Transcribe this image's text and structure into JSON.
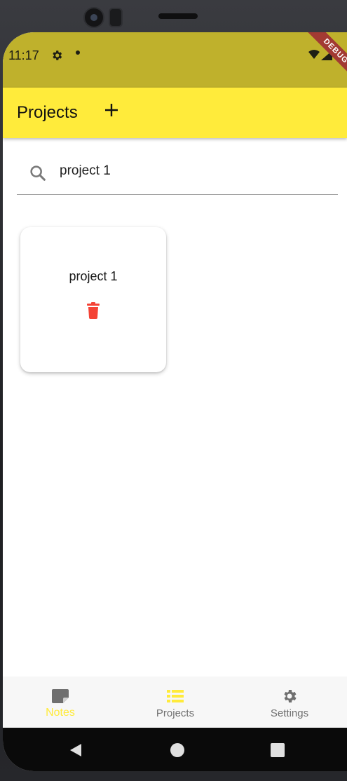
{
  "status_bar": {
    "time": "11:17",
    "debug_label": "DEBUG"
  },
  "app_bar": {
    "title": "Projects",
    "add_icon": "plus-icon"
  },
  "search": {
    "value": "project 1",
    "placeholder": "",
    "icon": "search-icon"
  },
  "projects": [
    {
      "name": "project 1",
      "action_icon": "trash-icon"
    }
  ],
  "bottom_nav": {
    "items": [
      {
        "label": "Notes",
        "icon": "note-icon",
        "active": true
      },
      {
        "label": "Projects",
        "icon": "list-icon",
        "active": false
      },
      {
        "label": "Settings",
        "icon": "gear-icon",
        "active": false
      }
    ]
  },
  "colors": {
    "status_bar": "#bfb12c",
    "app_bar": "#ffeb3b",
    "active_nav": "#ffeb3b",
    "delete": "#f44336",
    "inactive_nav": "#6f6f6f"
  }
}
